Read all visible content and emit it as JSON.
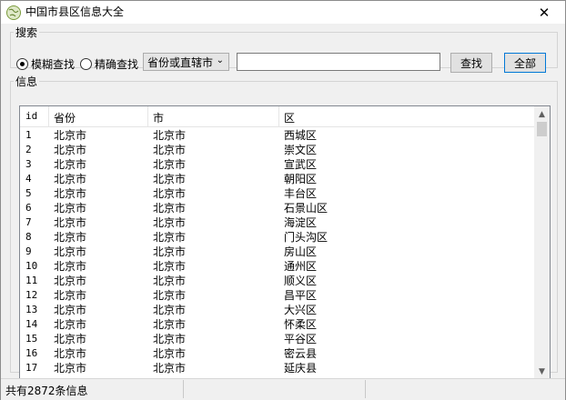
{
  "window": {
    "title": "中国市县区信息大全",
    "close_symbol": "✕"
  },
  "search": {
    "group_label": "搜索",
    "radio_fuzzy": "模糊查找",
    "radio_exact": "精确查找",
    "selected_mode": "模糊查找",
    "dropdown_value": "省份或直辖市",
    "text_value": "",
    "find_button": "查找",
    "all_button": "全部"
  },
  "info": {
    "group_label": "信息",
    "columns": [
      "id",
      "省份",
      "市",
      "区"
    ],
    "rows": [
      [
        "1",
        "北京市",
        "北京市",
        "西城区"
      ],
      [
        "2",
        "北京市",
        "北京市",
        "崇文区"
      ],
      [
        "3",
        "北京市",
        "北京市",
        "宣武区"
      ],
      [
        "4",
        "北京市",
        "北京市",
        "朝阳区"
      ],
      [
        "5",
        "北京市",
        "北京市",
        "丰台区"
      ],
      [
        "6",
        "北京市",
        "北京市",
        "石景山区"
      ],
      [
        "7",
        "北京市",
        "北京市",
        "海淀区"
      ],
      [
        "8",
        "北京市",
        "北京市",
        "门头沟区"
      ],
      [
        "9",
        "北京市",
        "北京市",
        "房山区"
      ],
      [
        "10",
        "北京市",
        "北京市",
        "通州区"
      ],
      [
        "11",
        "北京市",
        "北京市",
        "顺义区"
      ],
      [
        "12",
        "北京市",
        "北京市",
        "昌平区"
      ],
      [
        "13",
        "北京市",
        "北京市",
        "大兴区"
      ],
      [
        "14",
        "北京市",
        "北京市",
        "怀柔区"
      ],
      [
        "15",
        "北京市",
        "北京市",
        "平谷区"
      ],
      [
        "16",
        "北京市",
        "北京市",
        "密云县"
      ],
      [
        "17",
        "北京市",
        "北京市",
        "延庆县"
      ]
    ]
  },
  "status": {
    "text": "共有2872条信息"
  },
  "colors": {
    "accent": "#0078d7",
    "window_bg": "#f0f0f0"
  },
  "icons": {
    "app": "globe-icon",
    "close": "close-icon",
    "dropdown": "chevron-down-icon"
  }
}
